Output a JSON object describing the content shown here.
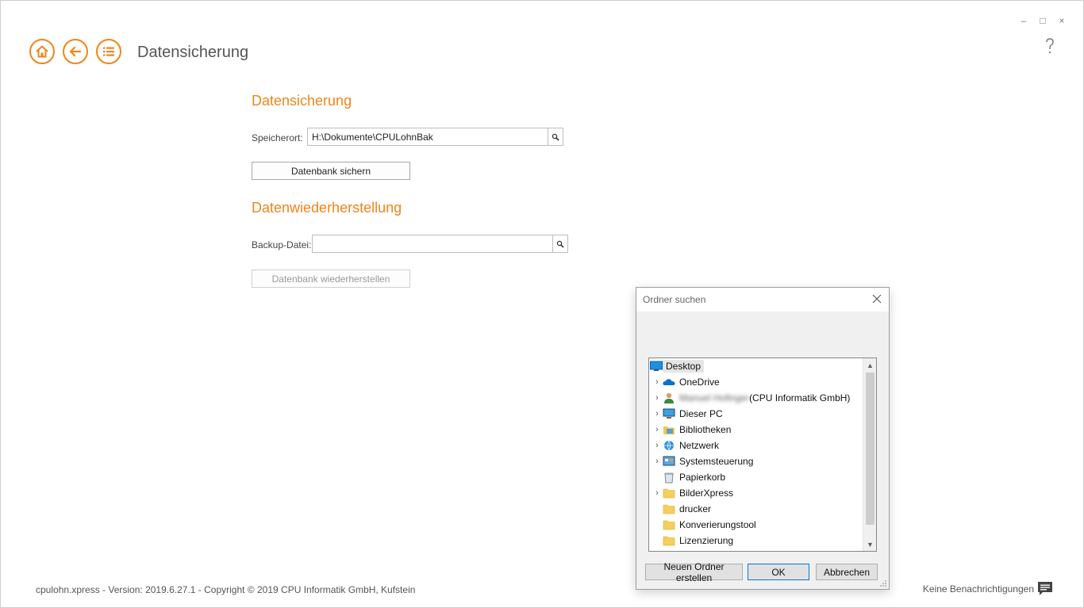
{
  "window": {
    "controls": {
      "minimize": "–",
      "maximize": "□",
      "close": "×"
    }
  },
  "nav": {
    "home_icon": "home-icon",
    "back_icon": "back-arrow-icon",
    "menu_icon": "list-icon",
    "page_title": "Datensicherung"
  },
  "backup": {
    "heading": "Datensicherung",
    "location_label": "Speicherort:",
    "location_value": "H:\\Dokumente\\CPULohnBak",
    "save_button": "Datenbank sichern"
  },
  "restore": {
    "heading": "Datenwiederherstellung",
    "file_label": "Backup-Datei:",
    "file_value": "",
    "restore_button": "Datenbank wiederherstellen"
  },
  "footer": {
    "version_text": "cpulohn.xpress - Version: 2019.6.27.1 - Copyright ©  2019 CPU Informatik GmbH, Kufstein",
    "notifications_text": "Keine Benachrichtigungen"
  },
  "dialog": {
    "title": "Ordner suchen",
    "tree": [
      {
        "label": "Desktop",
        "icon": "desktop-icon",
        "expandable": false,
        "root": true
      },
      {
        "label": "OneDrive",
        "icon": "cloud-icon",
        "expandable": true
      },
      {
        "label": "Manuel Hofinger",
        "suffix": "(CPU Informatik GmbH)",
        "icon": "user-icon",
        "expandable": true,
        "blurred": true
      },
      {
        "label": "Dieser PC",
        "icon": "computer-icon",
        "expandable": true
      },
      {
        "label": "Bibliotheken",
        "icon": "library-icon",
        "expandable": true
      },
      {
        "label": "Netzwerk",
        "icon": "network-icon",
        "expandable": true
      },
      {
        "label": "Systemsteuerung",
        "icon": "control-panel-icon",
        "expandable": true
      },
      {
        "label": "Papierkorb",
        "icon": "recycle-bin-icon",
        "expandable": false
      },
      {
        "label": "BilderXpress",
        "icon": "folder-icon",
        "expandable": true
      },
      {
        "label": "drucker",
        "icon": "folder-icon",
        "expandable": false
      },
      {
        "label": "Konverierungstool",
        "icon": "folder-icon",
        "expandable": false
      },
      {
        "label": "Lizenzierung",
        "icon": "folder-icon",
        "expandable": false
      }
    ],
    "new_folder_button": "Neuen Ordner erstellen",
    "ok_button": "OK",
    "cancel_button": "Abbrechen"
  },
  "colors": {
    "accent": "#f0851a",
    "heading": "#f0851a"
  }
}
